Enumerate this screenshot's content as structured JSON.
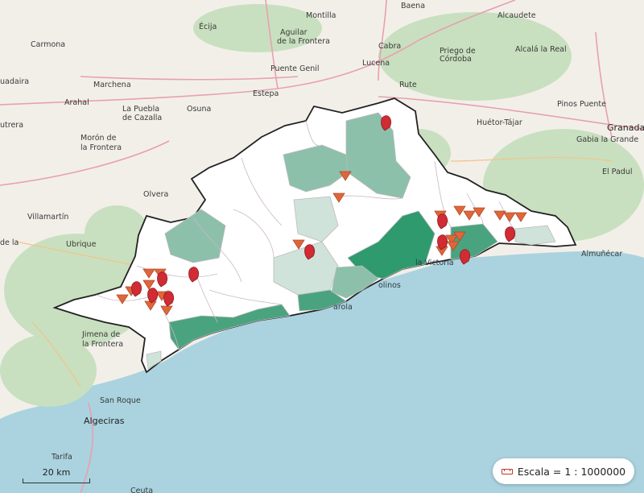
{
  "map": {
    "scale_bar_label": "20 km",
    "scale_text": "Escala = 1 : 1000000",
    "colors": {
      "sea": "#aad3df",
      "land": "#f2efe9",
      "forest": "#c8e0bf",
      "region_fill": "#ffffff",
      "region_border": "#222222",
      "choropleth_light": "#cfe3da",
      "choropleth_mid": "#8cc0aa",
      "choropleth_dark": "#4aa37f",
      "choropleth_darkest": "#2e9a6e",
      "marker_pin": "#d12b33",
      "marker_triangle": "#e0663a"
    },
    "marker_symbols": [
      "map-pin-icon",
      "triangle-down-icon"
    ],
    "places": [
      {
        "name": "Baena"
      },
      {
        "name": "Alcaudete"
      },
      {
        "name": "Montilla"
      },
      {
        "name": "Aguilar"
      },
      {
        "name": "de la Frontera"
      },
      {
        "name": "Écija"
      },
      {
        "name": "Carmona"
      },
      {
        "name": "Cabra"
      },
      {
        "name": "Priego de"
      },
      {
        "name": "Córdoba"
      },
      {
        "name": "Alcalá la Real"
      },
      {
        "name": "Puente Genil"
      },
      {
        "name": "Lucena"
      },
      {
        "name": "uadaira"
      },
      {
        "name": "Marchena"
      },
      {
        "name": "Rute"
      },
      {
        "name": "Arahal"
      },
      {
        "name": "La Puebla"
      },
      {
        "name": "de Cazalla"
      },
      {
        "name": "Osuna"
      },
      {
        "name": "Estepa"
      },
      {
        "name": "Pinos Puente"
      },
      {
        "name": "Huétor-Tájar"
      },
      {
        "name": "Granada"
      },
      {
        "name": "utrera"
      },
      {
        "name": "Morón de"
      },
      {
        "name": "la Frontera"
      },
      {
        "name": "Gabia la Grande"
      },
      {
        "name": "El Padul"
      },
      {
        "name": "Olvera"
      },
      {
        "name": "Villamartín"
      },
      {
        "name": "de la"
      },
      {
        "name": "Ubrique"
      },
      {
        "name": "Almuñécar"
      },
      {
        "name": "la Victoria"
      },
      {
        "name": "olinos"
      },
      {
        "name": "arola"
      },
      {
        "name": "Jimena de"
      },
      {
        "name": "la Frontera"
      },
      {
        "name": "San Roque"
      },
      {
        "name": "Algeciras"
      },
      {
        "name": "Tarifa"
      },
      {
        "name": "Ceuta"
      }
    ]
  }
}
